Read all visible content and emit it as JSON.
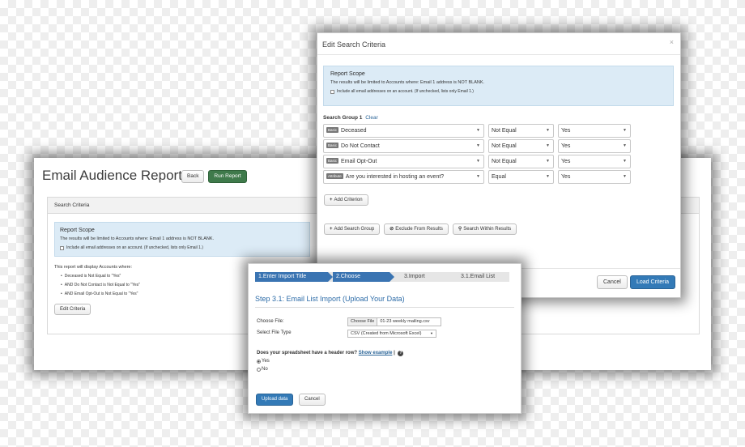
{
  "report": {
    "title": "Email Audience Report",
    "back_label": "Back",
    "run_label": "Run Report",
    "panel_title": "Search Criteria",
    "scope_title": "Report Scope",
    "scope_text": "The results will be limited to Accounts where: Email 1 address is NOT BLANK.",
    "scope_check": "Include all email addresses on an account. (If unchecked, lists only Email 1.)",
    "display_text": "This report will display Accounts where:",
    "criteria": [
      "Deceased is Not Equal to \"Yes\"",
      "AND Do Not Contact is Not Equal to \"Yes\"",
      "AND Email Opt-Out is Not Equal to \"Yes\""
    ],
    "edit_label": "Edit Criteria"
  },
  "modal": {
    "title": "Edit Search Criteria",
    "close": "×",
    "scope_title": "Report Scope",
    "scope_text": "The results will be limited to Accounts where: Email 1 address is NOT BLANK.",
    "scope_check": "Include all email addresses on an account. (If unchecked, lists only Email 1.)",
    "group_label": "Search Group 1",
    "clear_label": "Clear",
    "rows": [
      {
        "tag": "Basic",
        "field": "Deceased",
        "op": "Not Equal",
        "value": "Yes"
      },
      {
        "tag": "Basic",
        "field": "Do Not Contact",
        "op": "Not Equal",
        "value": "Yes"
      },
      {
        "tag": "Basic",
        "field": "Email Opt-Out",
        "op": "Not Equal",
        "value": "Yes"
      },
      {
        "tag": "Attribute",
        "field": "Are you interested in hosting an event?",
        "op": "Equal",
        "value": "Yes"
      }
    ],
    "add_criterion": "Add Criterion",
    "add_group": "Add Search Group",
    "exclude": "Exclude From Results",
    "search_within": "Search Within Results",
    "cancel": "Cancel",
    "load": "Load Criteria"
  },
  "import": {
    "steps": [
      "1.Enter Import Title",
      "2.Choose",
      "3.Import",
      "3.1.Email List"
    ],
    "step_title": "Step 3.1: Email List Import (Upload Your Data)",
    "choose_file_label": "Choose File:",
    "choose_file_button": "Choose File",
    "file_name": "01-23 weekly mailing.csv",
    "file_type_label": "Select File Type",
    "file_type_value": "CSV (Created from Microsoft Excel)",
    "header_question": "Does your spreadsheet have a header row?",
    "show_example": "Show example",
    "help": "?",
    "yes": "Yes",
    "no": "No",
    "upload": "Upload data",
    "cancel": "Cancel"
  },
  "colors": {
    "primary_blue": "#337ab7",
    "run_green": "#3f7a4b",
    "info_bg": "#dcebf6"
  }
}
